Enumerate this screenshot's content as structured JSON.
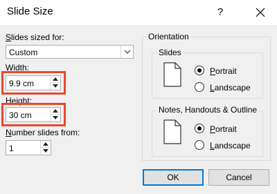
{
  "dialog": {
    "title": "Slide Size",
    "help": "?"
  },
  "slides_sized_for": {
    "label_u": "S",
    "label_rest": "lides sized for:",
    "value": "Custom"
  },
  "width": {
    "label_u": "W",
    "label_rest": "idth:",
    "value": "9.9 cm"
  },
  "height": {
    "label_u": "H",
    "label_rest": "eight:",
    "value": "30 cm"
  },
  "number_from": {
    "label_u": "N",
    "label_rest": "umber slides from:",
    "value": "1"
  },
  "orientation": {
    "title": "Orientation",
    "slides": {
      "title": "Slides",
      "portrait_u": "P",
      "portrait_rest": "ortrait",
      "landscape_u": "L",
      "landscape_rest": "andscape",
      "selected": "portrait"
    },
    "notes": {
      "title": "Notes, Handouts & Outline",
      "portrait_u": "P",
      "portrait_rest": "ortrait",
      "landscape_u": "L",
      "landscape_rest": "andscape",
      "selected": "portrait"
    }
  },
  "buttons": {
    "ok": "OK",
    "cancel": "Cancel"
  },
  "colors": {
    "highlight": "#e8482c",
    "focus": "#0078d7"
  },
  "icons": [
    "help-icon",
    "close-icon",
    "chevron-down-icon",
    "spin-up-icon",
    "spin-down-icon",
    "portrait-page-icon"
  ]
}
